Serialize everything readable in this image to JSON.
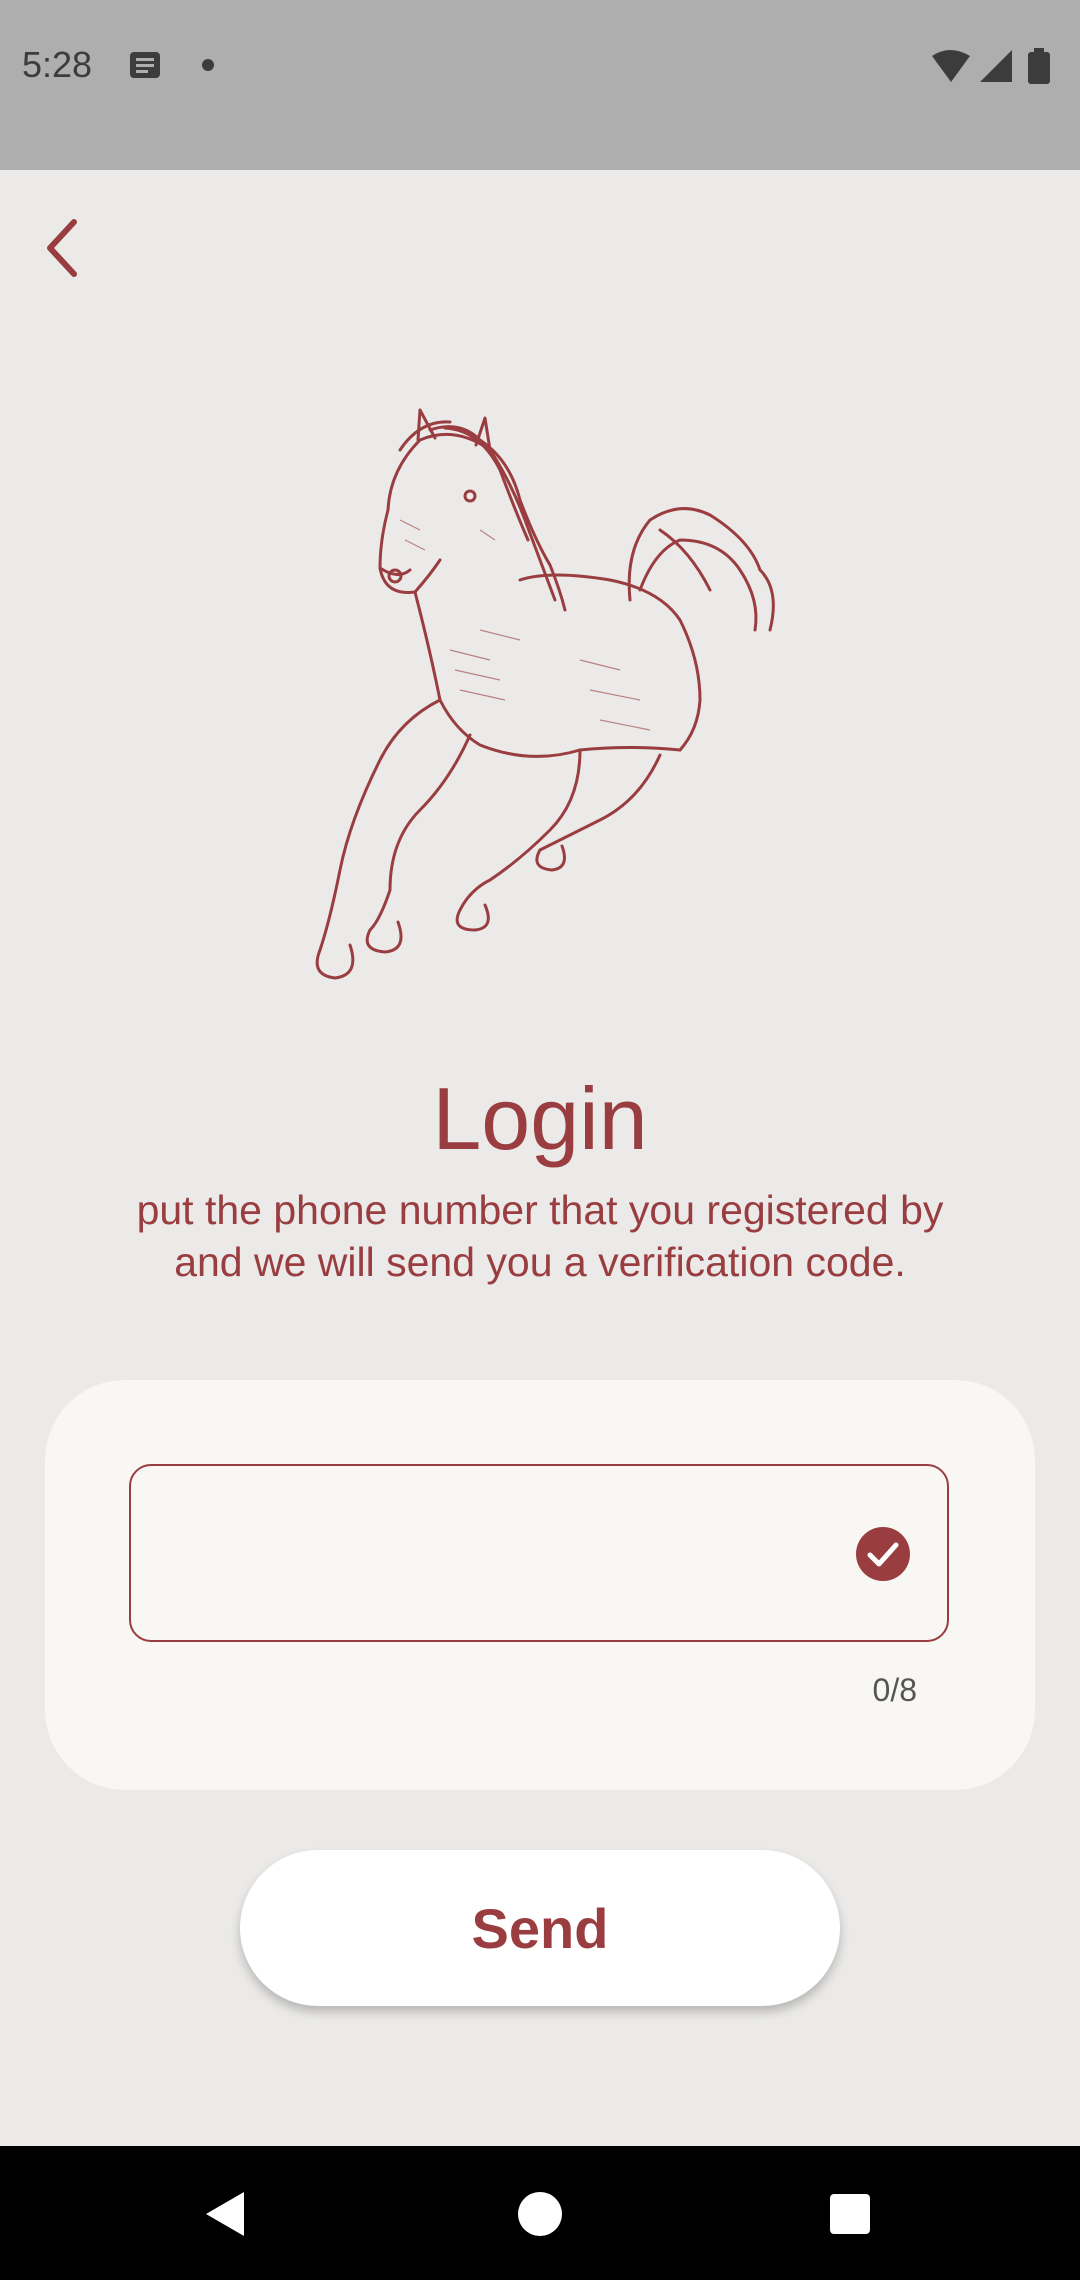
{
  "status_bar": {
    "time": "5:28",
    "left_icons": [
      "notification-icon",
      "dot-icon"
    ],
    "right_icons": [
      "wifi-icon",
      "signal-icon",
      "battery-icon"
    ]
  },
  "header": {
    "back_icon": "chevron-left-icon"
  },
  "hero": {
    "illustration": "horse-illustration"
  },
  "login": {
    "title": "Login",
    "subtitle_line1": "put the phone number that you registered by",
    "subtitle_line2": "and we will send you a verification code.",
    "phone_value": "",
    "counter": "0/8",
    "send_label": "Send"
  },
  "nav_bar": {
    "buttons": [
      "back-triangle-icon",
      "home-circle-icon",
      "recents-square-icon"
    ]
  },
  "colors": {
    "accent": "#9a3d40",
    "background": "#ebeae8",
    "card": "#f8f7f4"
  }
}
